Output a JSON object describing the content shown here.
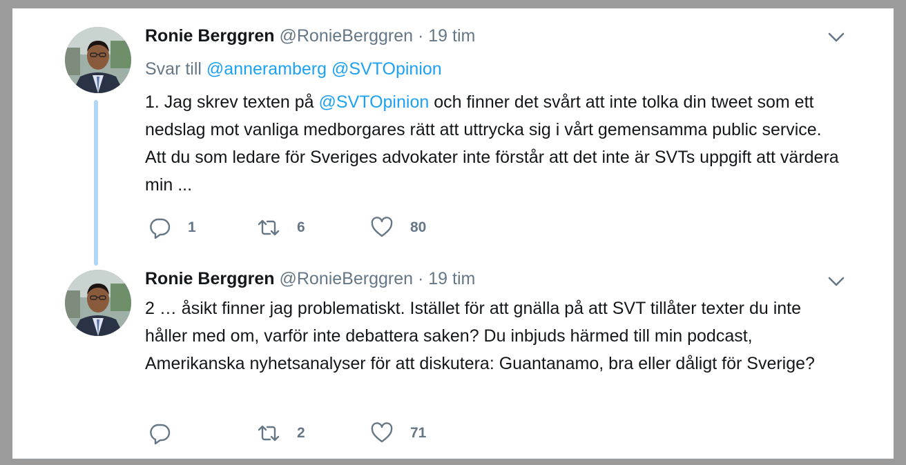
{
  "tweets": [
    {
      "author_name": "Ronie Berggren",
      "author_handle": "@RonieBerggren",
      "separator": "·",
      "time": "19 tim",
      "reply_prefix": "Svar till",
      "reply_mentions": [
        "@anneramberg",
        "@SVTOpinion"
      ],
      "text_part1": "1. Jag skrev texten på ",
      "text_mention": "@SVTOpinion",
      "text_part2": " och finner det svårt att inte tolka din tweet som ett nedslag mot vanliga medborgares rätt att uttrycka sig i vårt gemensamma public service. Att du som ledare för Sveriges advokater inte förstår att det inte är SVTs uppgift att värdera min ...",
      "reply_count": "1",
      "retweet_count": "6",
      "like_count": "80"
    },
    {
      "author_name": "Ronie Berggren",
      "author_handle": "@RonieBerggren",
      "separator": "·",
      "time": "19 tim",
      "text": "2 … åsikt finner jag problematiskt. Istället för att gnälla på att SVT  tillåter texter du inte håller med om, varför inte debattera saken? Du  inbjuds härmed till min podcast, Amerikanska nyhetsanalyser för att  diskutera: Guantanamo, bra eller dåligt för Sverige?",
      "reply_count": "",
      "retweet_count": "2",
      "like_count": "71"
    }
  ],
  "colors": {
    "link": "#1da1f2",
    "secondary_text": "#657786",
    "primary_text": "#14171a",
    "thread_line": "#b0d8f5"
  },
  "icons": [
    "reply-icon",
    "retweet-icon",
    "like-icon",
    "caret-down-icon"
  ]
}
